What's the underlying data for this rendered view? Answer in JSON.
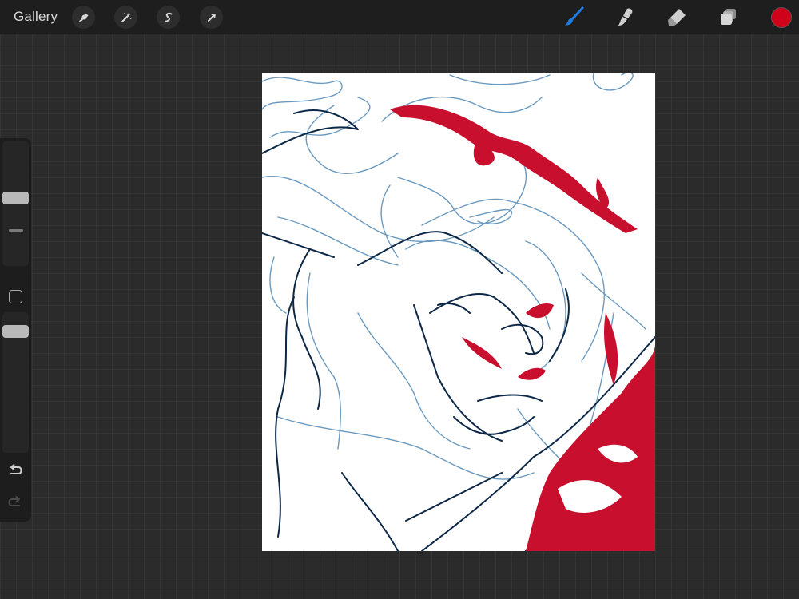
{
  "topbar": {
    "gallery_label": "Gallery",
    "left_tools": [
      {
        "name": "actions",
        "icon": "wrench-icon"
      },
      {
        "name": "adjustments",
        "icon": "magic-wand-icon"
      },
      {
        "name": "selection",
        "icon": "selection-s-icon"
      },
      {
        "name": "transform",
        "icon": "arrow-cursor-icon"
      }
    ],
    "right_tools": [
      {
        "name": "brush",
        "icon": "brush-icon",
        "active": true
      },
      {
        "name": "smudge",
        "icon": "smudge-icon",
        "active": false
      },
      {
        "name": "eraser",
        "icon": "eraser-icon",
        "active": false
      },
      {
        "name": "layers",
        "icon": "layers-icon",
        "active": false
      }
    ],
    "current_color": "#d0021b",
    "active_tool_color": "#1f7ae0"
  },
  "sidebar": {
    "brush_size_level": 0.55,
    "opacity_level": 0.9,
    "icons": [
      "modify-square-icon",
      "undo-icon",
      "redo-icon"
    ]
  },
  "canvas": {
    "background": "#ffffff",
    "sketch_colors": {
      "light_line": "#5c8fb8",
      "dark_line": "#0d2847",
      "accent_red": "#c8102e"
    }
  }
}
